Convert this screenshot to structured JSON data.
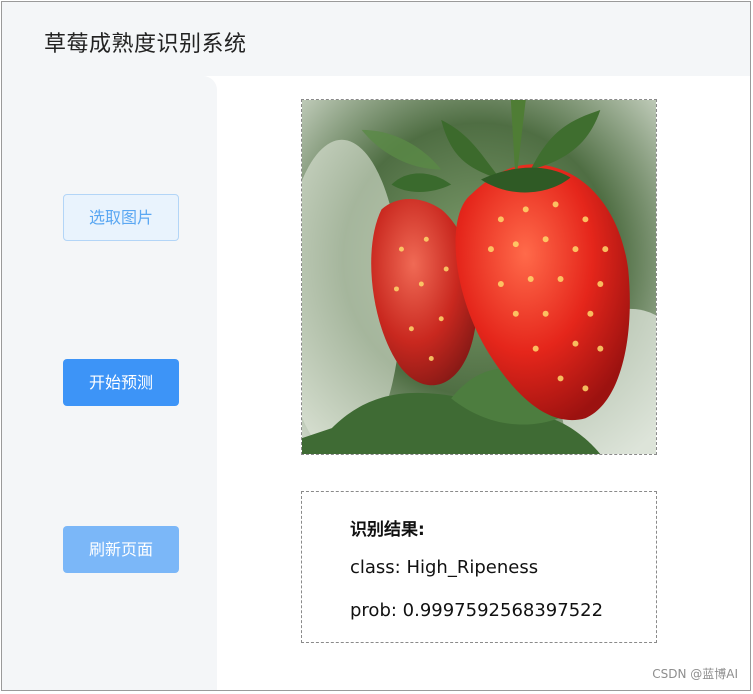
{
  "app": {
    "title": "草莓成熟度识别系统"
  },
  "sidebar": {
    "buttons": {
      "select": "选取图片",
      "predict": "开始预测",
      "refresh": "刷新页面"
    }
  },
  "image": {
    "icon": "strawberry-photo"
  },
  "result": {
    "title": "识别结果:",
    "class_line": "class: High_Ripeness",
    "prob_line": "prob: 0.9997592568397522"
  },
  "footer": {
    "watermark": "CSDN @蓝博AI"
  },
  "colors": {
    "primary": "#3d94f7",
    "primary_light": "#7bb7f8",
    "plain_bg": "#e9f3fd",
    "sidebar_bg": "#f4f6f8"
  }
}
